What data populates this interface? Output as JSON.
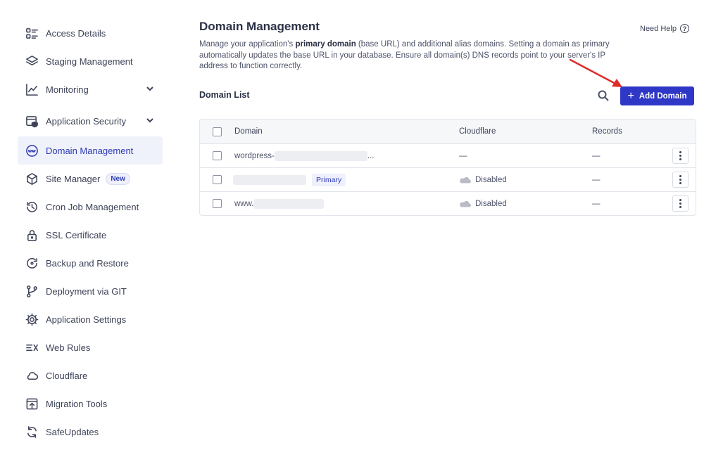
{
  "sidebar": {
    "items": [
      {
        "label": "Access Details",
        "icon": "access-details-icon"
      },
      {
        "label": "Staging Management",
        "icon": "layers-icon"
      },
      {
        "label": "Monitoring",
        "icon": "line-chart-icon",
        "expandable": true
      },
      {
        "label": "Application Security",
        "icon": "shield-window-icon",
        "expandable": true
      },
      {
        "label": "Domain Management",
        "icon": "www-globe-icon",
        "active": true
      },
      {
        "label": "Site Manager",
        "icon": "site-manager-icon",
        "badge": "New"
      },
      {
        "label": "Cron Job Management",
        "icon": "clock-history-icon"
      },
      {
        "label": "SSL Certificate",
        "icon": "lock-icon"
      },
      {
        "label": "Backup and Restore",
        "icon": "backup-icon"
      },
      {
        "label": "Deployment via GIT",
        "icon": "git-branch-icon"
      },
      {
        "label": "Application Settings",
        "icon": "gear-icon"
      },
      {
        "label": "Web Rules",
        "icon": "web-rules-icon"
      },
      {
        "label": "Cloudflare",
        "icon": "cloud-icon"
      },
      {
        "label": "Migration Tools",
        "icon": "migration-icon"
      },
      {
        "label": "SafeUpdates",
        "icon": "refresh-icon"
      }
    ]
  },
  "header": {
    "title": "Domain Management",
    "need_help": "Need Help",
    "desc_part1": "Manage your application's ",
    "desc_bold": "primary domain",
    "desc_part2": " (base URL) and additional alias domains. Setting a domain as primary automatically updates the base URL in your database. Ensure all domain(s) DNS records point to your server's IP address to function correctly."
  },
  "domain_list": {
    "title": "Domain List",
    "add_button": "Add Domain",
    "columns": [
      "Domain",
      "Cloudflare",
      "Records"
    ],
    "rows": [
      {
        "domain": "wordpress-",
        "domain_suffix": "...",
        "primary": "",
        "cloudflare": "—",
        "records": "—"
      },
      {
        "domain": "",
        "domain_suffix": "",
        "primary": "Primary",
        "cloudflare": "Disabled",
        "records": "—"
      },
      {
        "domain": "www.",
        "domain_suffix": "",
        "primary": "",
        "cloudflare": "Disabled",
        "records": "—"
      }
    ]
  },
  "colors": {
    "accent": "#2e37c6",
    "active_bg": "#eff1fb",
    "arrow": "#e02a2a"
  }
}
